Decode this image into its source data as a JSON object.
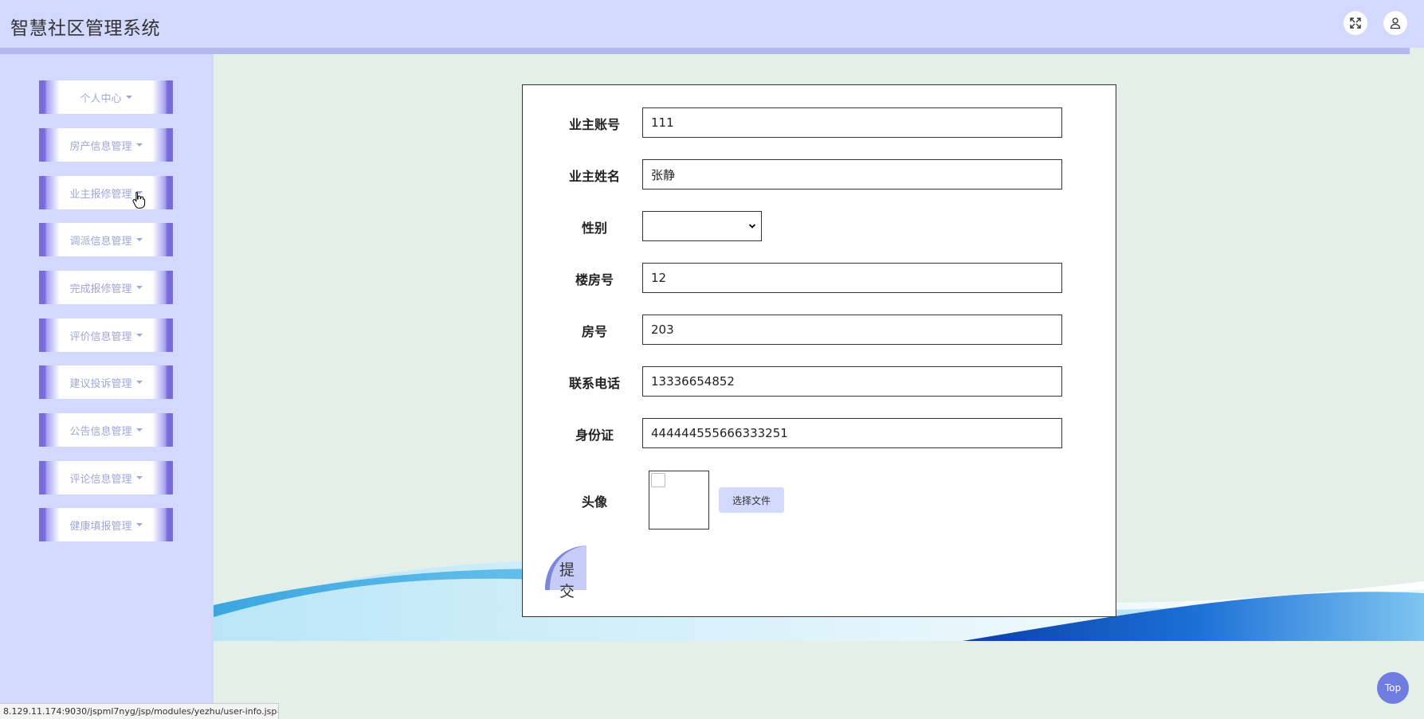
{
  "header": {
    "title": "智慧社区管理系统",
    "fullscreen_icon": "expand-icon",
    "user_icon": "user-icon"
  },
  "sidebar": {
    "items": [
      {
        "label": "个人中心"
      },
      {
        "label": "房产信息管理"
      },
      {
        "label": "业主报修管理"
      },
      {
        "label": "调派信息管理"
      },
      {
        "label": "完成报修管理"
      },
      {
        "label": "评价信息管理"
      },
      {
        "label": "建议投诉管理"
      },
      {
        "label": "公告信息管理"
      },
      {
        "label": "评论信息管理"
      },
      {
        "label": "健康填报管理"
      }
    ]
  },
  "form": {
    "account_label": "业主账号",
    "account_value": "111",
    "name_label": "业主姓名",
    "name_value": "张静",
    "gender_label": "性别",
    "gender_value": "",
    "building_label": "楼房号",
    "building_value": "12",
    "room_label": "房号",
    "room_value": "203",
    "phone_label": "联系电话",
    "phone_value": "13336654852",
    "idcard_label": "身份证",
    "idcard_value": "444444555666333251",
    "avatar_label": "头像",
    "file_button": "选择文件",
    "submit_button": "提交"
  },
  "statusbar": {
    "url": "8.129.11.174:9030/jspml7nyg/jsp/modules/yezhu/user-info.jsp#"
  },
  "top_button": "Top",
  "colors": {
    "header_bg": "#d3d8fd",
    "accent": "#7b6ad9",
    "page_bg": "#e4efea"
  }
}
